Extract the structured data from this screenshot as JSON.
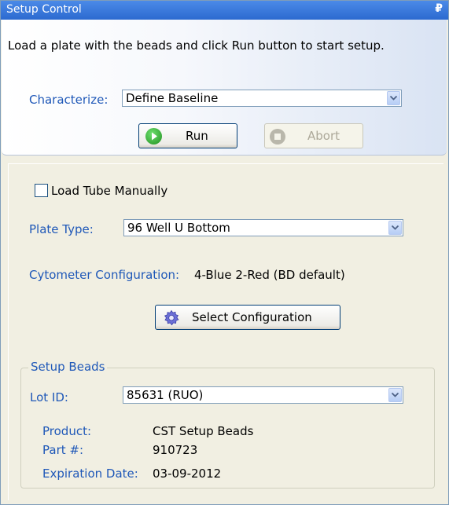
{
  "panel": {
    "title": "Setup Control",
    "pin_glyph": "₽",
    "instruction": "Load a plate with the beads and click Run button to start setup."
  },
  "characterize": {
    "label": "Characterize:",
    "value": "Define Baseline"
  },
  "buttons": {
    "run": "Run",
    "abort": "Abort",
    "select_configuration": "Select Configuration"
  },
  "load_tube": {
    "label": "Load Tube Manually",
    "checked": false
  },
  "plate_type": {
    "label": "Plate Type:",
    "value": "96 Well U Bottom"
  },
  "cytometer": {
    "label": "Cytometer Configuration:",
    "value": "4-Blue 2-Red (BD default)"
  },
  "setup_beads": {
    "title": "Setup Beads",
    "lot_label": "Lot ID:",
    "lot_value": "85631 (RUO)",
    "product_label": "Product:",
    "product_value": "CST Setup Beads",
    "part_label": "Part #:",
    "part_value": "910723",
    "expiration_label": "Expiration Date:",
    "expiration_value": "03-09-2012"
  },
  "colors": {
    "title_bar": "#2c6ad0",
    "label_blue": "#1f58b8",
    "run_icon_green": "#2aa52a"
  },
  "icons": [
    "pin-icon",
    "dropdown-arrow-icon",
    "play-icon",
    "stop-icon",
    "gear-icon"
  ]
}
